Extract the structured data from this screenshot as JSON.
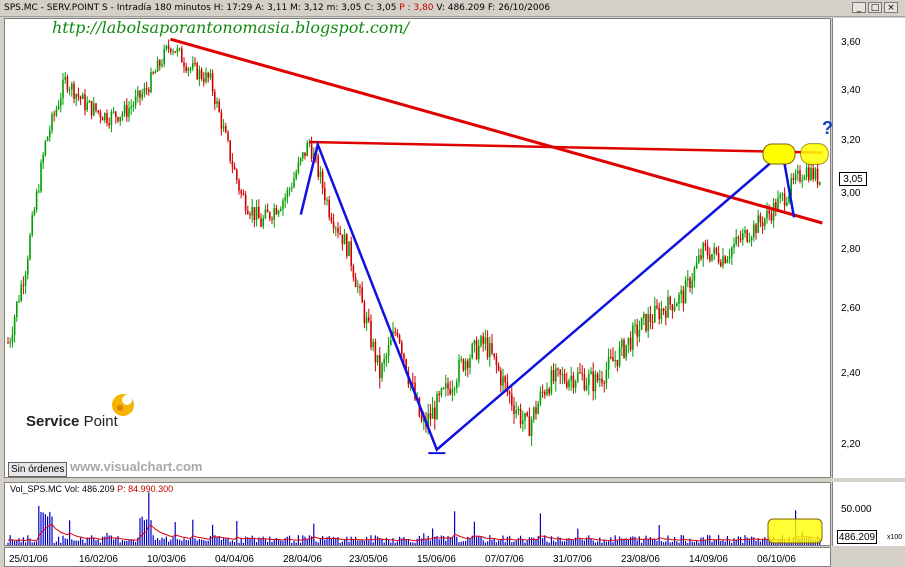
{
  "titlebar": {
    "symbol": "SPS.MC",
    "name": "SERV.POINT S",
    "interval": "Intradía 180 minutos",
    "high": "H: 17:29",
    "open": "A: 3,11",
    "max": "M: 3,12",
    "min_label": "m: 3,05",
    "close": "C: 3,05",
    "p": "P : 3,80",
    "volume": "V: 486.209",
    "date": "F: 26/10/2006"
  },
  "overlay": {
    "url": "http://labolsaporantonomasia.blogspot.com/",
    "logo_text_bold": "Service",
    "logo_text_light": "Point",
    "watermark": "www.visualchart.com",
    "orders_button": "Sin órdenes",
    "question_mark": "?"
  },
  "volume_panel": {
    "title": "Vol_SPS.MC",
    "vol": "Vol: 486.209",
    "p": "P: 84.990.300",
    "axis_label": "50.000",
    "last_box": "486.209",
    "scale_tag": "x100"
  },
  "colors": {
    "up_candle": "#00a000",
    "down_candle": "#d00000",
    "trendline_red": "#e00000",
    "pattern_blue": "#1010e0",
    "highlight": "#ffff00",
    "volume_bar": "#0000c0",
    "volume_avg": "#e00000"
  },
  "chart_data": {
    "type": "line",
    "title": "SPS.MC - SERV.POINT S - Intradía 180 minutos",
    "x_dates": [
      "25/01/06",
      "16/02/06",
      "10/03/06",
      "04/04/06",
      "28/04/06",
      "23/05/06",
      "15/06/06",
      "07/07/06",
      "31/07/06",
      "23/08/06",
      "14/09/06",
      "06/10/06"
    ],
    "y_ticks": [
      "3,60",
      "3,40",
      "3,20",
      "3,00",
      "2,80",
      "2,60",
      "2,40",
      "2,20"
    ],
    "ylim": [
      2.15,
      3.68
    ],
    "last_price": "3,05",
    "series": [
      {
        "x": [
          "12/01/06",
          "18/01/06",
          "25/01/06",
          "01/02/06",
          "08/02/06",
          "16/02/06",
          "22/02/06",
          "01/03/06",
          "10/03/06",
          "17/03/06",
          "24/03/06",
          "31/03/06",
          "04/04/06",
          "11/04/06",
          "20/04/06",
          "28/04/06",
          "05/05/06",
          "12/05/06",
          "17/05/06",
          "23/05/06",
          "29/05/06",
          "02/06/06",
          "07/06/06",
          "15/06/06",
          "22/06/06",
          "29/06/06",
          "07/07/06",
          "14/07/06",
          "21/07/06",
          "31/07/06",
          "07/08/06",
          "14/08/06",
          "23/08/06",
          "30/08/06",
          "07/09/06",
          "14/09/06",
          "21/09/06",
          "28/09/06",
          "06/10/06",
          "13/10/06",
          "20/10/06",
          "26/10/06"
        ],
        "y": [
          2.5,
          2.75,
          3.2,
          3.45,
          3.35,
          3.3,
          3.32,
          3.4,
          3.6,
          3.5,
          3.45,
          3.15,
          3.0,
          2.9,
          3.0,
          3.2,
          2.95,
          2.8,
          2.6,
          2.4,
          2.55,
          2.4,
          2.25,
          2.35,
          2.45,
          2.5,
          2.35,
          2.25,
          2.38,
          2.4,
          2.38,
          2.45,
          2.55,
          2.6,
          2.65,
          2.8,
          2.78,
          2.85,
          2.92,
          3.0,
          3.1,
          3.05
        ]
      }
    ],
    "annotations": [
      {
        "type": "trendline",
        "color": "red",
        "from": [
          "10/03/06",
          3.62
        ],
        "to": [
          "26/10/06",
          2.9
        ]
      },
      {
        "type": "horizontal",
        "color": "red",
        "from": [
          "28/04/06",
          3.2
        ],
        "to": [
          "26/10/06",
          3.16
        ]
      },
      {
        "type": "pattern",
        "color": "blue",
        "points": [
          [
            "25/04/06",
            2.93
          ],
          [
            "01/05/06",
            3.19
          ],
          [
            "12/06/06",
            2.19
          ],
          [
            "12/10/06",
            3.16
          ],
          [
            "16/10/06",
            2.92
          ]
        ]
      },
      {
        "type": "horizontal",
        "color": "blue",
        "from": [
          "09/06/06",
          2.18
        ],
        "to": [
          "15/06/06",
          2.18
        ]
      }
    ],
    "grid": false,
    "legend": "none"
  }
}
